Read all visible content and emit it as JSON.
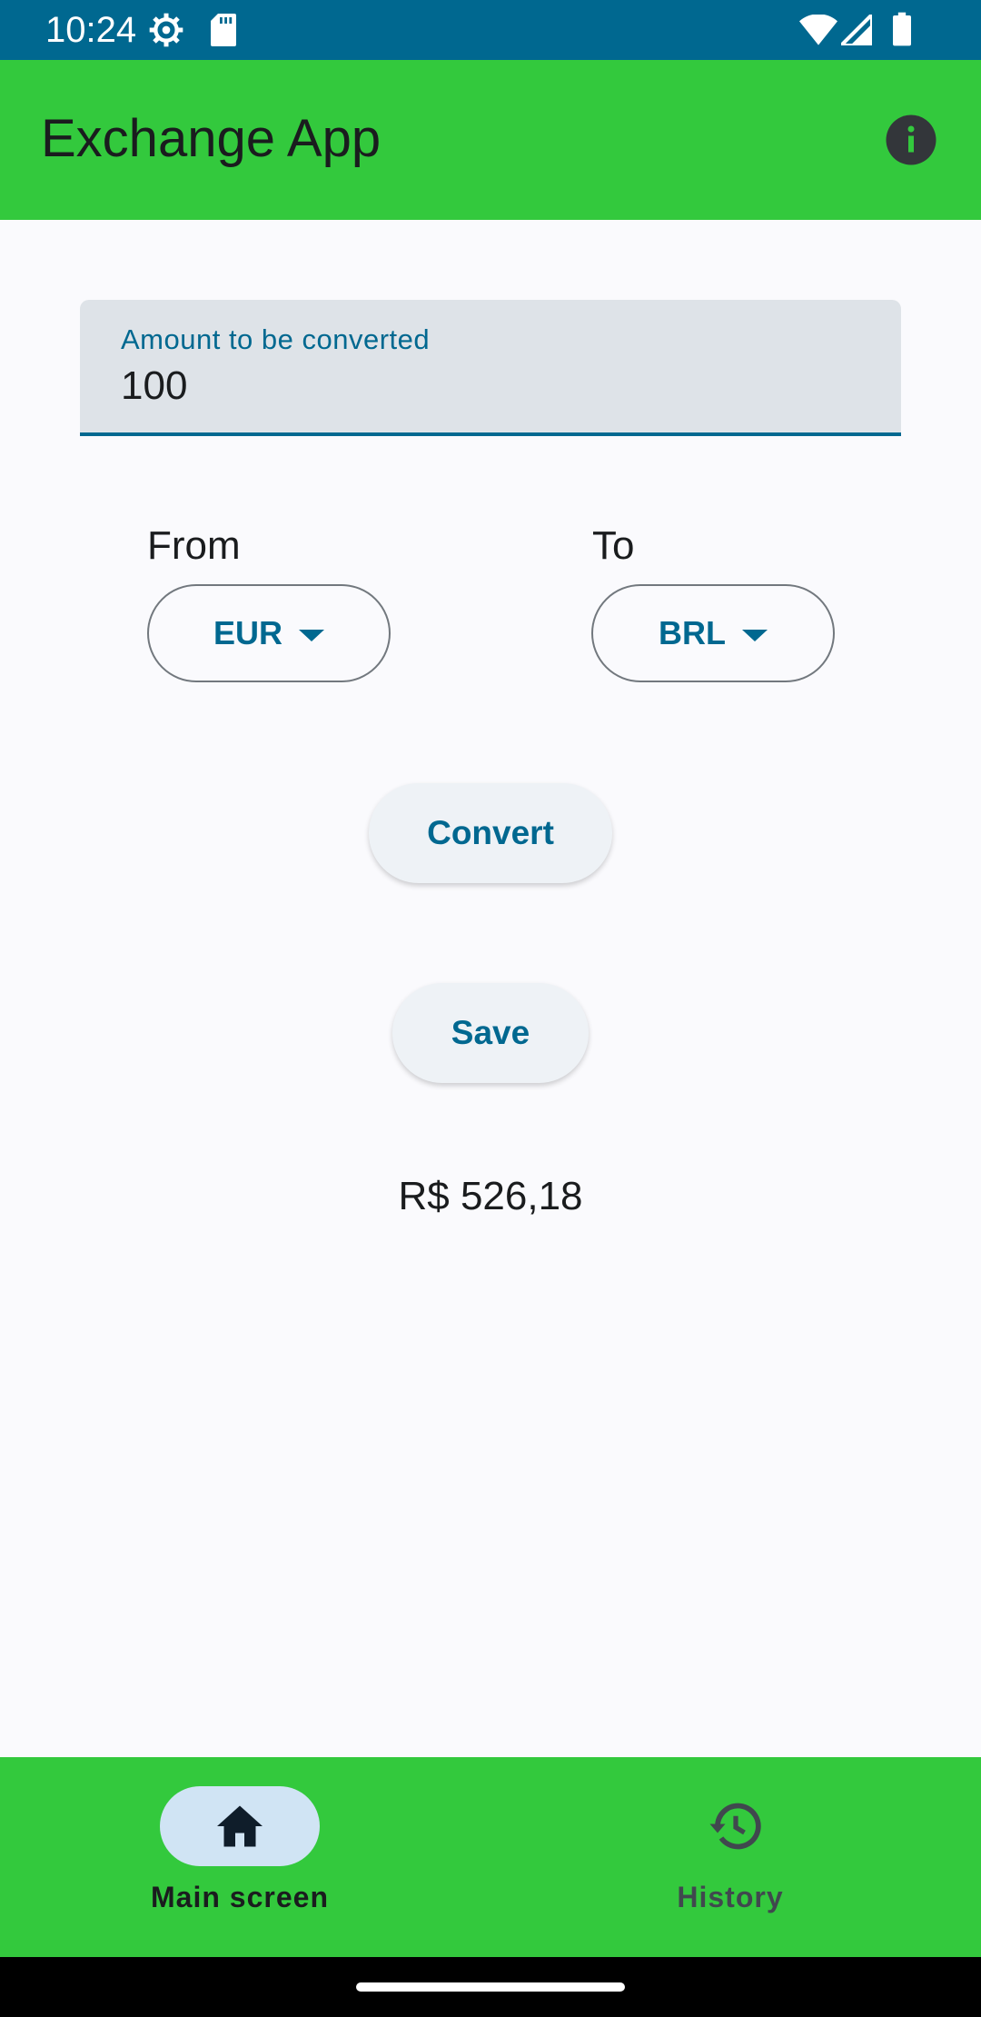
{
  "status_bar": {
    "time": "10:24",
    "background": "#006890",
    "icons": [
      "settings-icon",
      "sd-card-icon",
      "wifi-icon",
      "signal-icon",
      "battery-icon"
    ]
  },
  "app_bar": {
    "title": "Exchange App",
    "background": "#33c93d",
    "action_icon": "info-icon"
  },
  "amount_field": {
    "label": "Amount to be converted",
    "value": "100"
  },
  "from": {
    "label": "From",
    "selected": "EUR"
  },
  "to": {
    "label": "To",
    "selected": "BRL"
  },
  "actions": {
    "convert_label": "Convert",
    "save_label": "Save"
  },
  "result": {
    "text": "R$ 526,18"
  },
  "bottom_nav": {
    "background": "#33c93d",
    "items": [
      {
        "label": "Main screen",
        "icon": "home-icon",
        "selected": true
      },
      {
        "label": "History",
        "icon": "history-icon",
        "selected": false
      }
    ]
  },
  "colors": {
    "accent": "#006890",
    "surface": "#fafafd"
  }
}
